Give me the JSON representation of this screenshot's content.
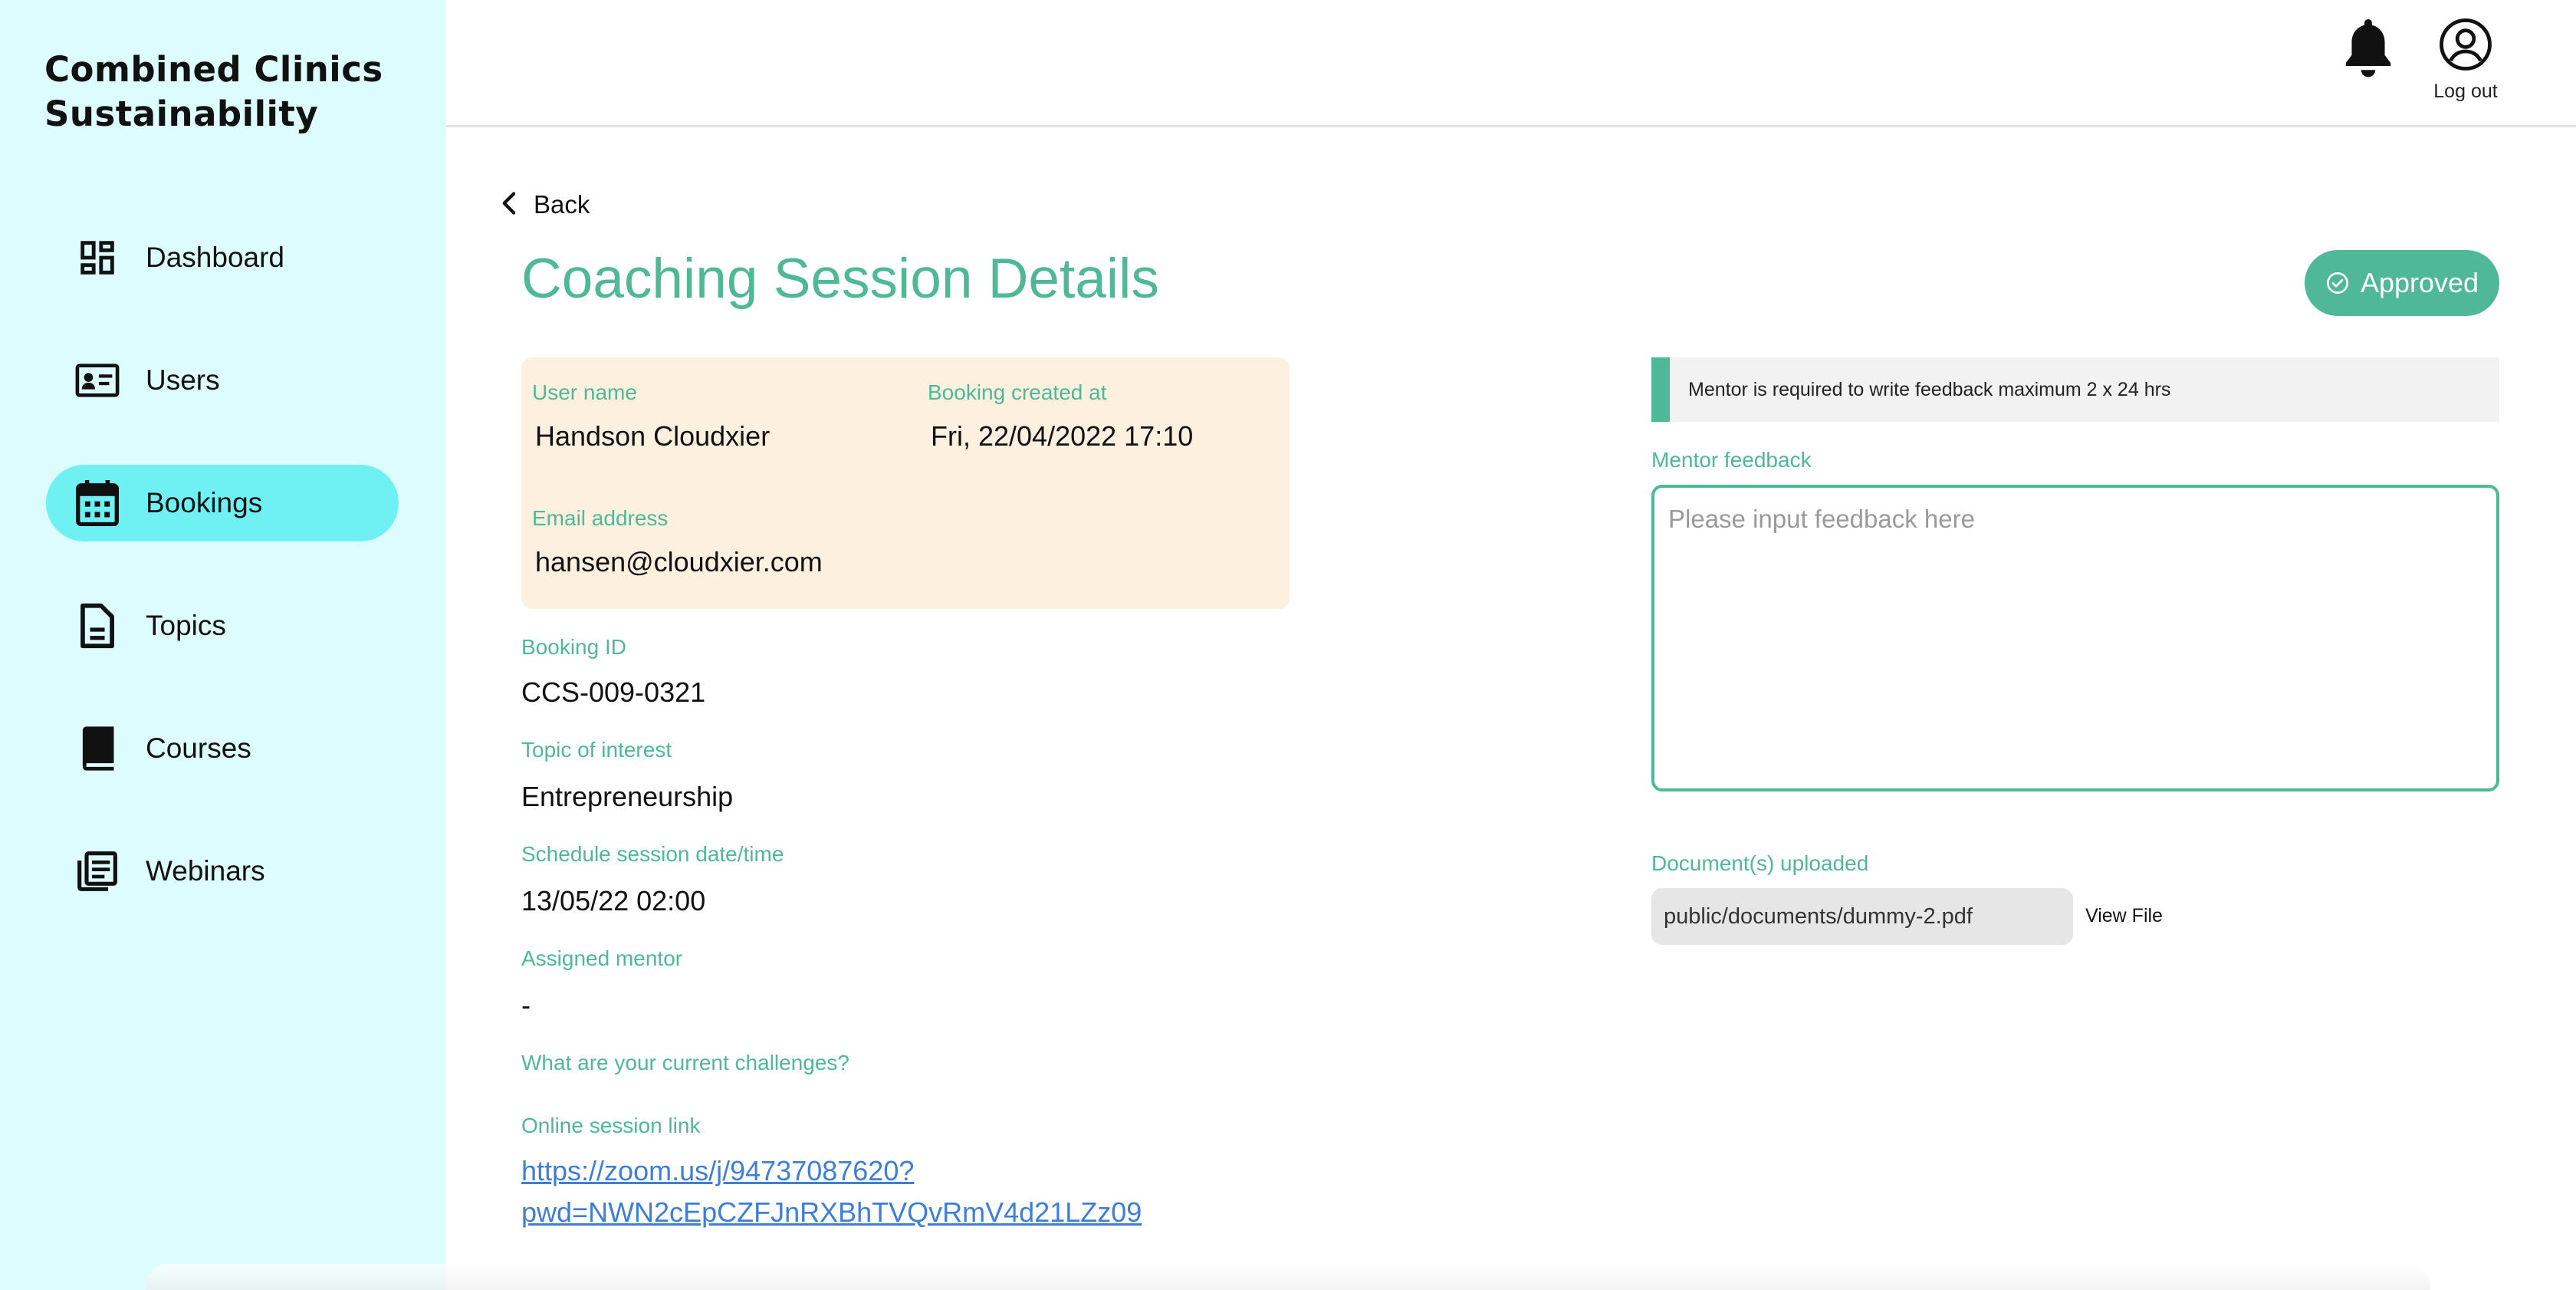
{
  "brand": {
    "line1": "Combined Clinics",
    "line2": "Sustainability"
  },
  "sidebar": {
    "items": [
      {
        "label": "Dashboard",
        "icon": "dashboard-icon",
        "active": false
      },
      {
        "label": "Users",
        "icon": "id-card-icon",
        "active": false
      },
      {
        "label": "Bookings",
        "icon": "calendar-icon",
        "active": true
      },
      {
        "label": "Topics",
        "icon": "document-icon",
        "active": false
      },
      {
        "label": "Courses",
        "icon": "book-icon",
        "active": false
      },
      {
        "label": "Webinars",
        "icon": "newspaper-icon",
        "active": false
      }
    ]
  },
  "header": {
    "logout_label": "Log out",
    "icons": [
      "bell-icon",
      "user-circle-icon"
    ]
  },
  "page": {
    "back_label": "Back",
    "title": "Coaching Session Details",
    "status": "Approved",
    "accent_color": "#4fb897"
  },
  "user_card": {
    "user_name_label": "User name",
    "user_name": "Handson Cloudxier",
    "booking_created_label": "Booking created at",
    "booking_created": "Fri, 22/04/2022 17:10",
    "email_label": "Email address",
    "email": "hansen@cloudxier.com"
  },
  "details": {
    "booking_id_label": "Booking ID",
    "booking_id": "CCS-009-0321",
    "topic_label": "Topic of interest",
    "topic": "Entrepreneurship",
    "schedule_label": "Schedule session date/time",
    "schedule": "13/05/22 02:00",
    "mentor_label": "Assigned mentor",
    "mentor": "-",
    "challenges_label": "What are your current challenges?",
    "session_link_label": "Online session link",
    "session_link_line1": "https://zoom.us/j/94737087620?",
    "session_link_line2": "pwd=NWN2cEpCZFJnRXBhTVQvRmV4d21LZz09"
  },
  "feedback": {
    "notice": "Mentor is required to write feedback maximum 2 x 24 hrs",
    "label": "Mentor feedback",
    "placeholder": "Please input feedback here",
    "documents_label": "Document(s) uploaded",
    "document_path": "public/documents/dummy-2.pdf",
    "view_file_label": "View File"
  }
}
